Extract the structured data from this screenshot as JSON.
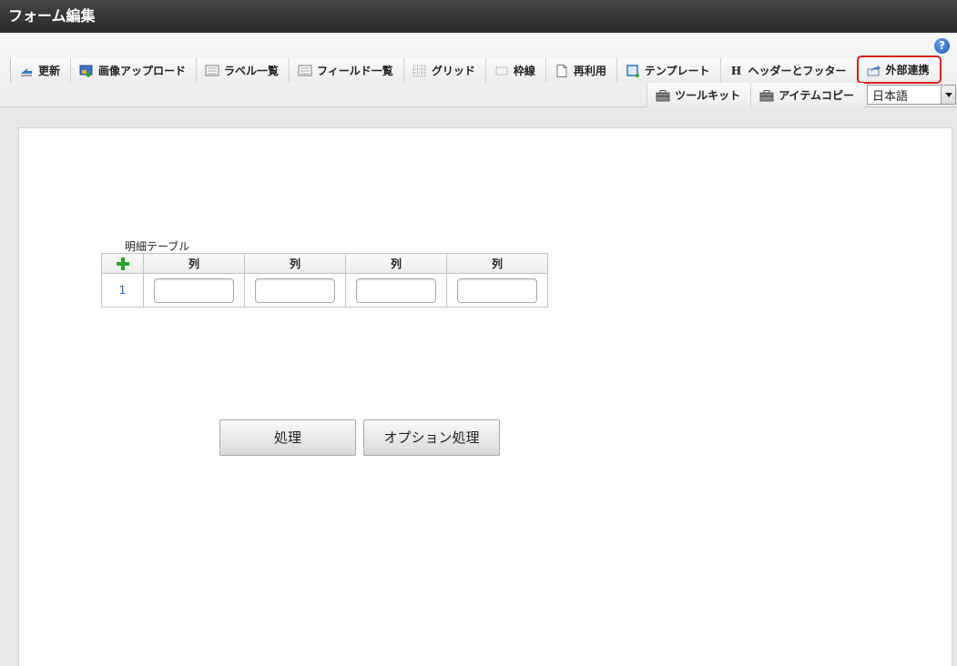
{
  "window": {
    "title": "フォーム編集"
  },
  "help": {
    "glyph": "?"
  },
  "toolbar": {
    "row1": [
      {
        "name": "refresh-button",
        "icon": "refresh-icon",
        "label": "更新"
      },
      {
        "name": "image-upload-button",
        "icon": "image-upload-icon",
        "label": "画像アップロード"
      },
      {
        "name": "label-list-button",
        "icon": "list-icon",
        "label": "ラベル一覧"
      },
      {
        "name": "field-list-button",
        "icon": "list-icon",
        "label": "フィールド一覧"
      },
      {
        "name": "grid-button",
        "icon": "grid-icon",
        "label": "グリッド"
      },
      {
        "name": "frame-border-button",
        "icon": "border-icon",
        "label": "枠線"
      },
      {
        "name": "reuse-button",
        "icon": "page-icon",
        "label": "再利用"
      },
      {
        "name": "template-button",
        "icon": "template-icon",
        "label": "テンプレート"
      },
      {
        "name": "header-footer-button",
        "icon": "header-icon",
        "label": "ヘッダーとフッター"
      },
      {
        "name": "external-integration-button",
        "icon": "external-link-icon",
        "label": "外部連携",
        "highlighted": true
      }
    ],
    "row2": [
      {
        "name": "toolkit-button",
        "icon": "toolbox-icon",
        "label": "ツールキット"
      },
      {
        "name": "item-copy-button",
        "icon": "toolbox-icon",
        "label": "アイテムコピー"
      }
    ],
    "language": {
      "selected": "日本語"
    },
    "header_icon_glyph": "H"
  },
  "form": {
    "table": {
      "caption": "明細テーブル",
      "columns": [
        "列",
        "列",
        "列",
        "列"
      ],
      "rows": [
        {
          "number": "1"
        }
      ]
    },
    "buttons": {
      "process": "処理",
      "option_process": "オプション処理"
    }
  },
  "colors": {
    "highlight": "#d62020",
    "add": "#2aa62a",
    "rownum": "#2a5ea8"
  }
}
